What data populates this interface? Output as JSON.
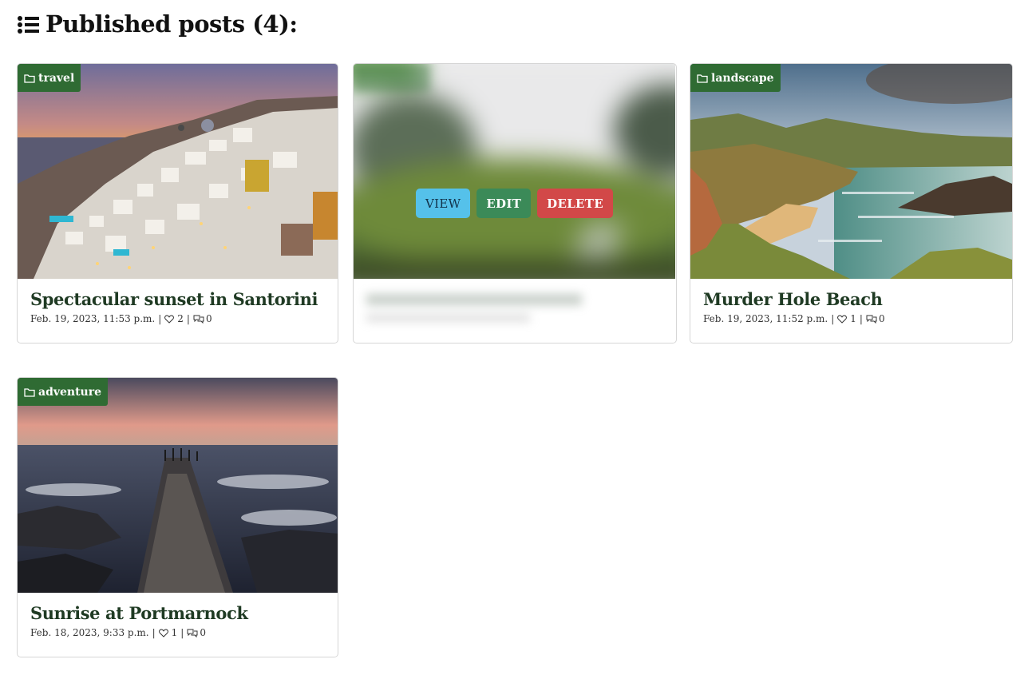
{
  "header": {
    "title": "Published posts (4):",
    "icon": "list-icon"
  },
  "colors": {
    "accent_green": "#2f6b33",
    "title_green": "#1f3a23",
    "view_button": "#55c1ea",
    "edit_button": "#3b8a58",
    "delete_button": "#d24848"
  },
  "posts": [
    {
      "category": "travel",
      "title": "Spectacular sunset in Santorini",
      "date": "Feb. 19, 2023, 11:53 p.m.",
      "likes": "2",
      "comments": "0"
    },
    {
      "category": "",
      "title": "",
      "date": "",
      "likes": "",
      "comments": "",
      "actions": {
        "view": "VIEW",
        "edit": "EDIT",
        "delete": "DELETE"
      }
    },
    {
      "category": "landscape",
      "title": "Murder Hole Beach",
      "date": "Feb. 19, 2023, 11:52 p.m.",
      "likes": "1",
      "comments": "0"
    },
    {
      "category": "adventure",
      "title": "Sunrise at Portmarnock",
      "date": "Feb. 18, 2023, 9:33 p.m.",
      "likes": "1",
      "comments": "0"
    }
  ],
  "meta_separator": "|"
}
